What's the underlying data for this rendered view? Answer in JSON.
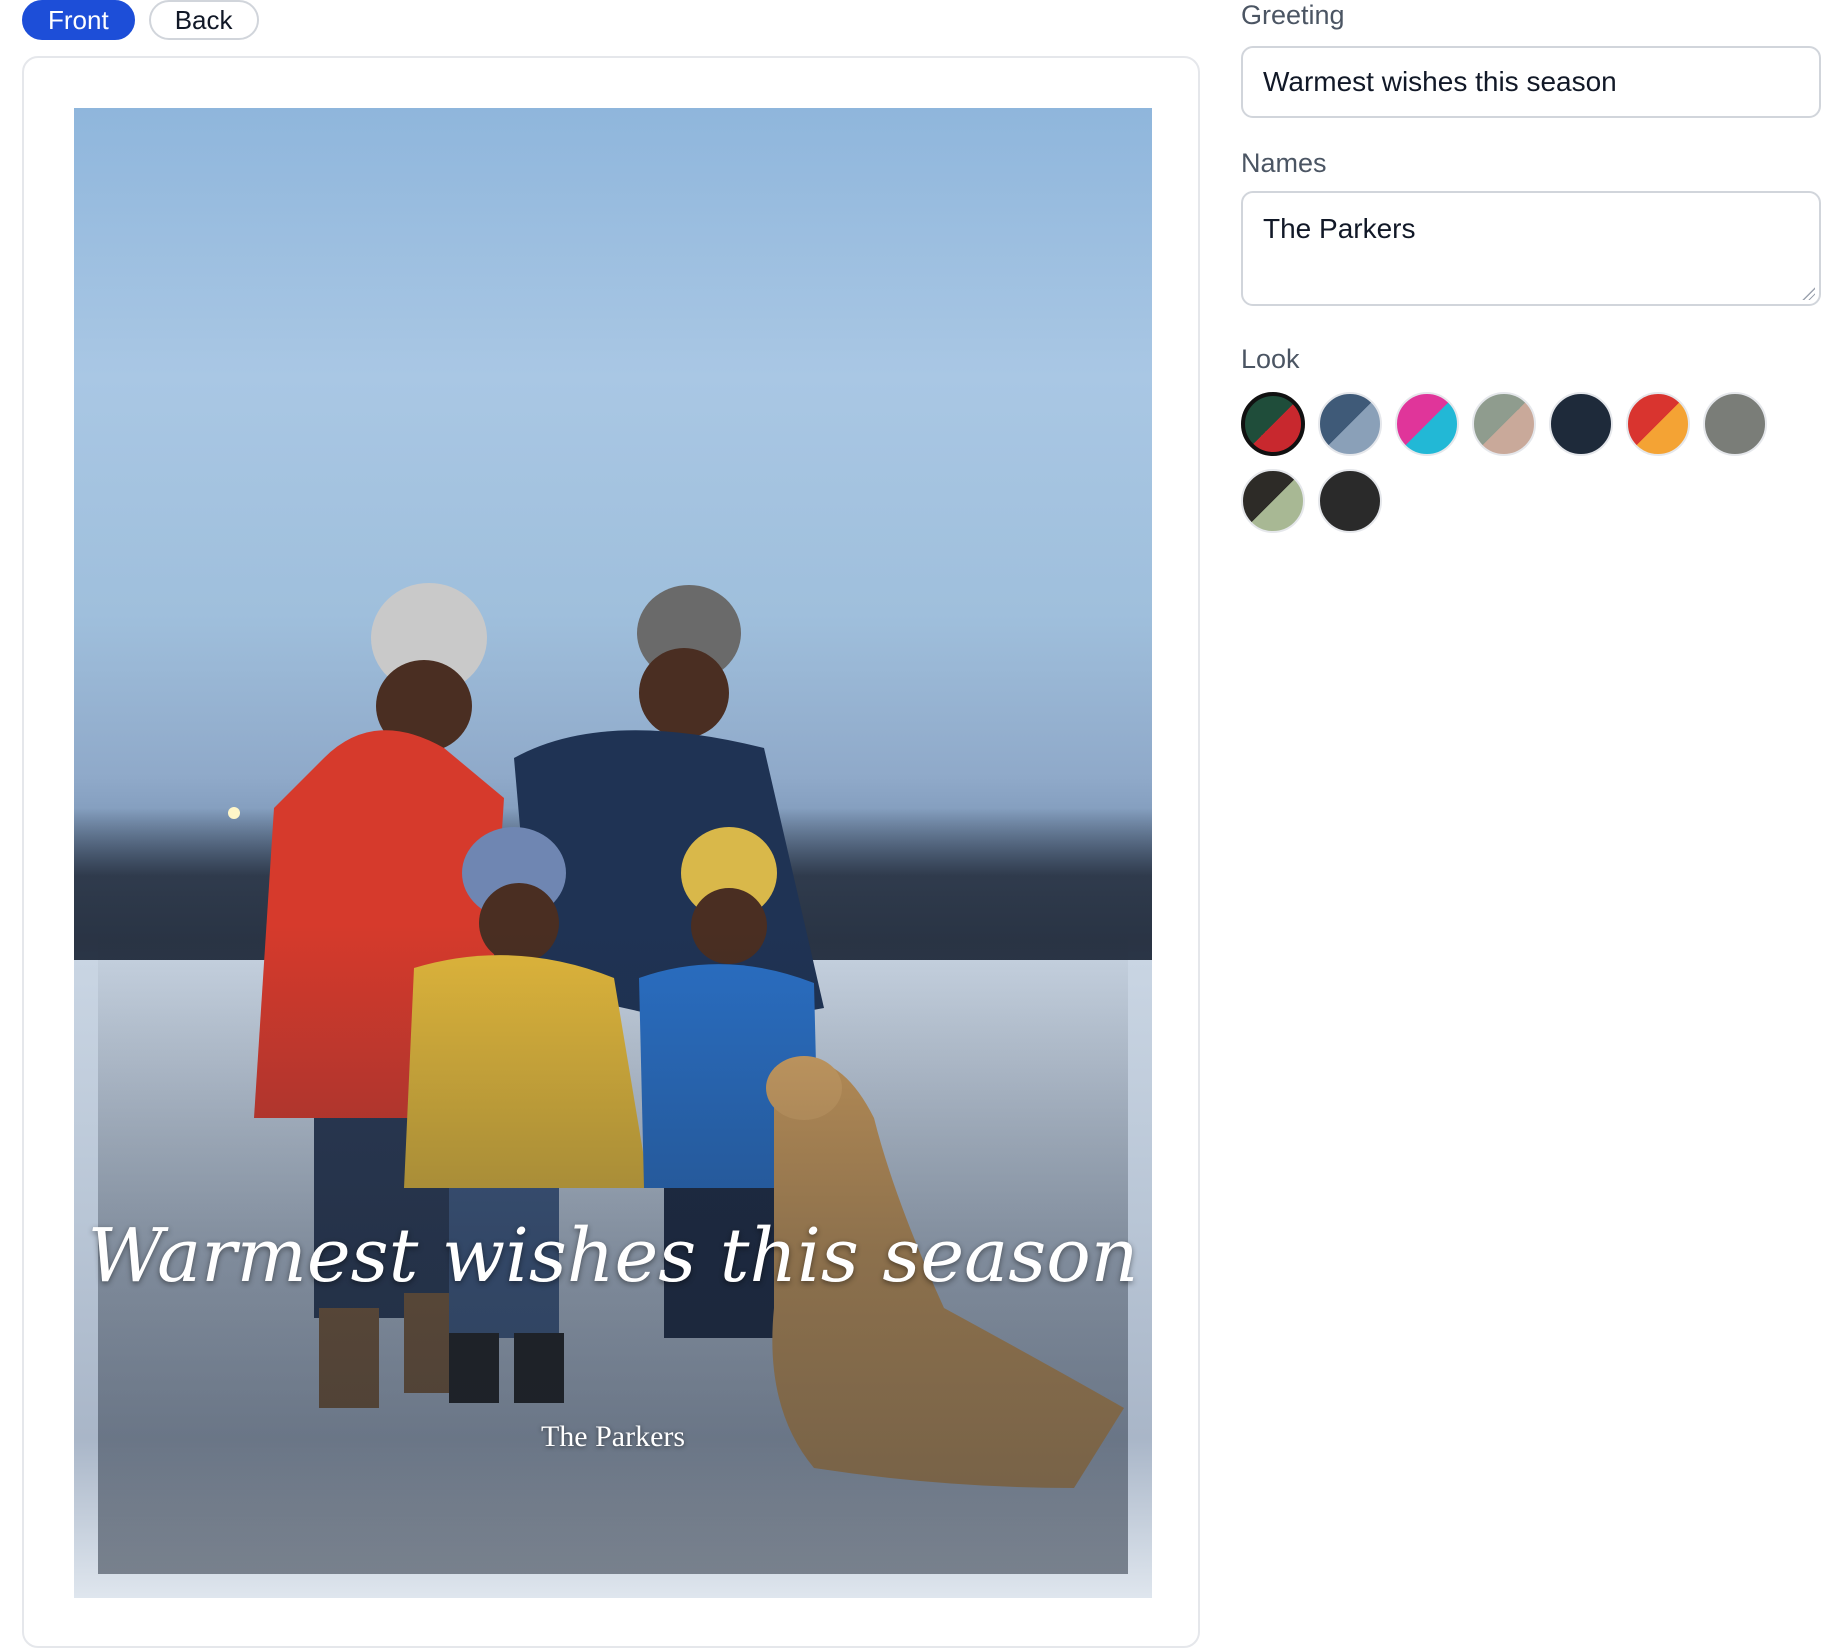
{
  "tabs": [
    {
      "label": "Front",
      "active": true
    },
    {
      "label": "Back",
      "active": false
    }
  ],
  "card": {
    "greeting": "Warmest wishes this season",
    "names": "The Parkers"
  },
  "form": {
    "greeting_label": "Greeting",
    "greeting_value": "Warmest wishes this season",
    "names_label": "Names",
    "names_value": "The Parkers",
    "look_label": "Look"
  },
  "looks": [
    {
      "name": "green-red",
      "colors": [
        "#1f4d3a",
        "#c8282e"
      ],
      "selected": true
    },
    {
      "name": "slate-blue",
      "colors": [
        "#3f5a78",
        "#8aa0b8"
      ],
      "selected": false
    },
    {
      "name": "pink-cyan",
      "colors": [
        "#e0359a",
        "#22b8d6"
      ],
      "selected": false
    },
    {
      "name": "sage-blush",
      "colors": [
        "#8f9c8e",
        "#c9a99a"
      ],
      "selected": false
    },
    {
      "name": "navy",
      "colors": [
        "#1e2a3a",
        "#1e2a3a"
      ],
      "selected": false
    },
    {
      "name": "red-orange",
      "colors": [
        "#d9342f",
        "#f4a334"
      ],
      "selected": false
    },
    {
      "name": "gray",
      "colors": [
        "#7a7d78",
        "#7a7d78"
      ],
      "selected": false
    },
    {
      "name": "charcoal-olive",
      "colors": [
        "#2d2b27",
        "#a8b894"
      ],
      "selected": false
    },
    {
      "name": "black",
      "colors": [
        "#2a2a2a",
        "#2a2a2a"
      ],
      "selected": false
    }
  ]
}
